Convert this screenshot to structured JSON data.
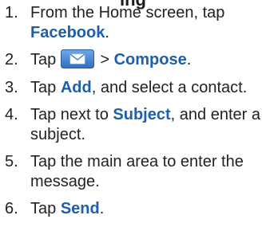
{
  "heading_fragment": "ing",
  "steps": [
    {
      "num": "1.",
      "before": "From the Home screen, tap ",
      "keyword": "Facebook",
      "after": "."
    },
    {
      "num": "2.",
      "before": "Tap ",
      "icon": "mail-icon",
      "middle": " > ",
      "keyword": "Compose",
      "after": "."
    },
    {
      "num": "3.",
      "before": "Tap ",
      "keyword": "Add",
      "after": ", and select a contact."
    },
    {
      "num": "4.",
      "before": "Tap next to ",
      "keyword": "Subject",
      "after": ", and enter a subject."
    },
    {
      "num": "5.",
      "text": "Tap the main area to enter the message."
    },
    {
      "num": "6.",
      "before": "Tap ",
      "keyword": "Send",
      "after": "."
    }
  ],
  "colors": {
    "keyword": "#1f5ea8",
    "text": "#222222",
    "icon_bg": "#3a7fd0"
  }
}
